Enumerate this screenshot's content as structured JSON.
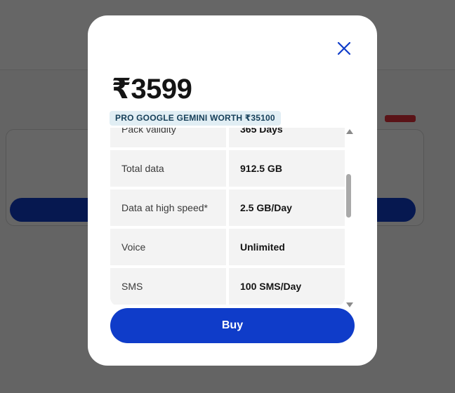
{
  "modal": {
    "price": "₹3599",
    "promo": "PRO GOOGLE GEMINI WORTH ₹35100",
    "close_icon": "close-icon",
    "details": [
      {
        "label": "Pack validity",
        "value": "365 Days"
      },
      {
        "label": "Total data",
        "value": "912.5 GB"
      },
      {
        "label": "Data at high speed*",
        "value": "2.5 GB/Day"
      },
      {
        "label": "Voice",
        "value": "Unlimited"
      },
      {
        "label": "SMS",
        "value": "100 SMS/Day"
      }
    ],
    "buy_label": "Buy"
  },
  "colors": {
    "primary": "#0f3cc9",
    "close": "#0f3cc9",
    "promo_bg": "#e1eef4"
  }
}
